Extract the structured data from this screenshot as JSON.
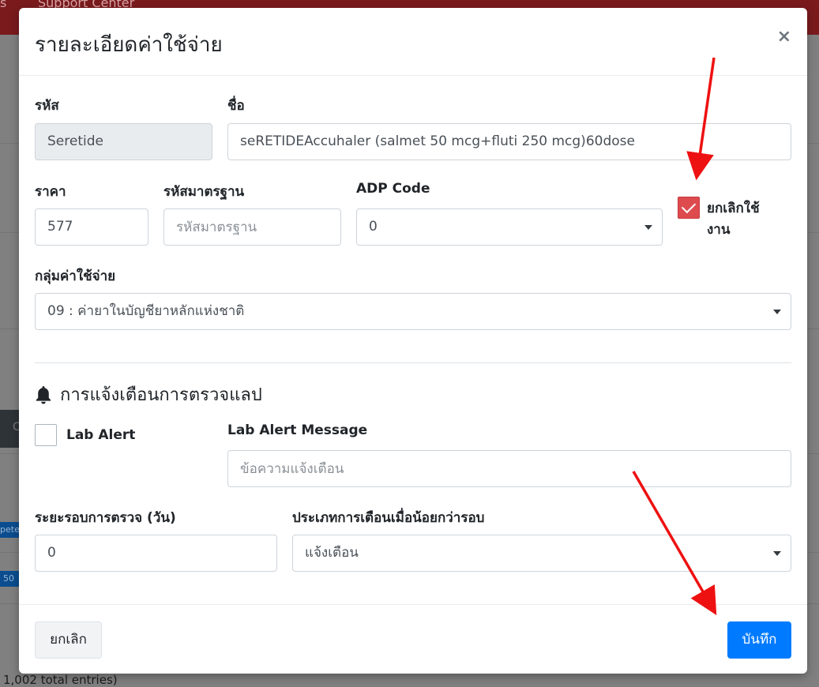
{
  "background": {
    "nav_text_left": "s",
    "nav_text_support": "Support Center",
    "dark_button_text": "C",
    "badge_1": "pete",
    "badge_2": "50",
    "footer_text": "1,002 total entries)"
  },
  "modal": {
    "title": "รายละเอียดค่าใช้จ่าย",
    "close_symbol": "×",
    "fields": {
      "code_label": "รหัส",
      "code_value": "Seretide",
      "name_label": "ชื่อ",
      "name_value": "seRETIDEAccuhaler (salmet 50 mcg+fluti 250 mcg)60dose",
      "price_label": "ราคา",
      "price_value": "577",
      "std_code_label": "รหัสมาตรฐาน",
      "std_code_placeholder": "รหัสมาตรฐาน",
      "adp_label": "ADP Code",
      "adp_value": "0",
      "cancel_use_label_line1": "ยกเลิกใช้",
      "cancel_use_label_line2": "งาน",
      "cancel_use_checked": true,
      "group_label": "กลุ่มค่าใช้จ่าย",
      "group_value": "09 : ค่ายาในบัญชียาหลักแห่งชาติ"
    },
    "lab_section": {
      "title": "การแจ้งเตือนการตรวจแลป",
      "icon": "bell-icon",
      "lab_alert_label": "Lab Alert",
      "lab_alert_checked": false,
      "message_label": "Lab Alert Message",
      "message_placeholder": "ข้อความแจ้งเตือน",
      "interval_label": "ระยะรอบการตรวจ (วัน)",
      "interval_value": "0",
      "alert_type_label": "ประเภทการเตือนเมื่อน้อยกว่ารอบ",
      "alert_type_value": "แจ้งเตือน"
    },
    "footer": {
      "cancel_label": "ยกเลิก",
      "save_label": "บันทึก"
    }
  },
  "colors": {
    "primary": "#007bff",
    "checkbox_checked": "#dd4b4f",
    "annotation_arrow": "#ee1111"
  }
}
